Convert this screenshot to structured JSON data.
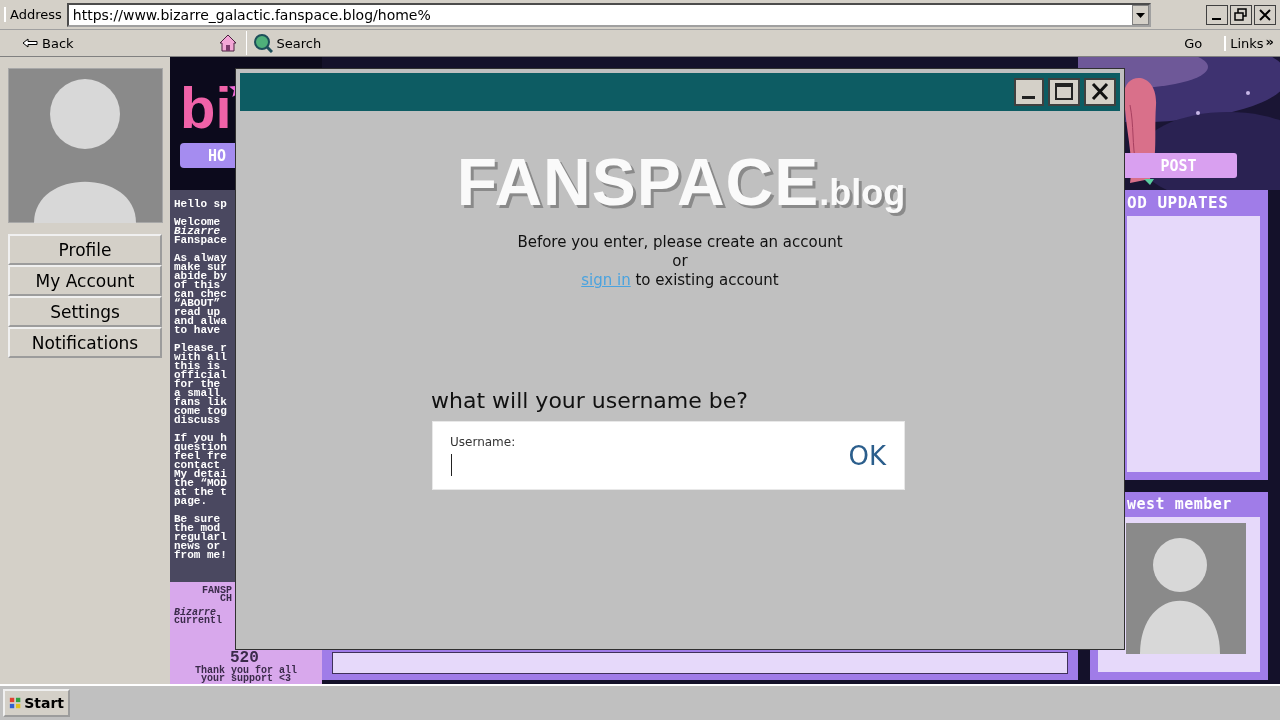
{
  "browser": {
    "address_label": "Address",
    "url": "https://www.bizarre_galactic.fanspace.blog/home%",
    "toolbar": [
      {
        "kind": "back",
        "label": "Back"
      },
      {
        "kind": "home"
      },
      {
        "kind": "search",
        "label": "Search"
      }
    ],
    "go": "Go",
    "links": "Links",
    "links_more": "»"
  },
  "sidebar": {
    "buttons": [
      "Profile",
      "My Account",
      "Settings",
      "Notifications"
    ]
  },
  "site": {
    "logo": "bi",
    "nav_left": "HO",
    "nav_right": "POST",
    "welcome_paragraphs": [
      [
        "Hello sp"
      ],
      [
        "Welcome",
        "*Bizarre*",
        "Fanspace"
      ],
      [
        "As alway",
        "make sur",
        "abide by",
        "of this",
        "can chec",
        "“ABOUT”",
        "read up",
        "and alwa",
        "to have"
      ],
      [
        "Please r",
        "with all",
        "this is",
        "official",
        "for the",
        "a small",
        "fans lik",
        "come tog",
        "discuss"
      ],
      [
        "If you h",
        "question",
        "feel fre",
        "contact",
        "My detai",
        "the “MOD",
        "at the t",
        "page."
      ],
      [
        "Be sure",
        "the mod",
        "regularl",
        "news or",
        "from me!"
      ]
    ],
    "counter": {
      "title_lines": [
        "FANSP",
        "CH"
      ],
      "desc_lines": [
        "*Bizarre*",
        "currentl"
      ],
      "count": "520",
      "thanks_lines": [
        "Thank you for all",
        "your support <3"
      ]
    },
    "mod_updates_title": "OD UPDATES",
    "newest_member_title": "west member"
  },
  "dialog": {
    "heading": "FANSPACE",
    "heading_suffix": ".blog",
    "lines": [
      "Before you enter, please create an account",
      "or"
    ],
    "link": "sign in",
    "link_tail": "to existing account",
    "prompt": "what will your username be?",
    "field": {
      "label": "Username:"
    },
    "ok": "OK"
  },
  "taskbar": {
    "start": "Start"
  }
}
